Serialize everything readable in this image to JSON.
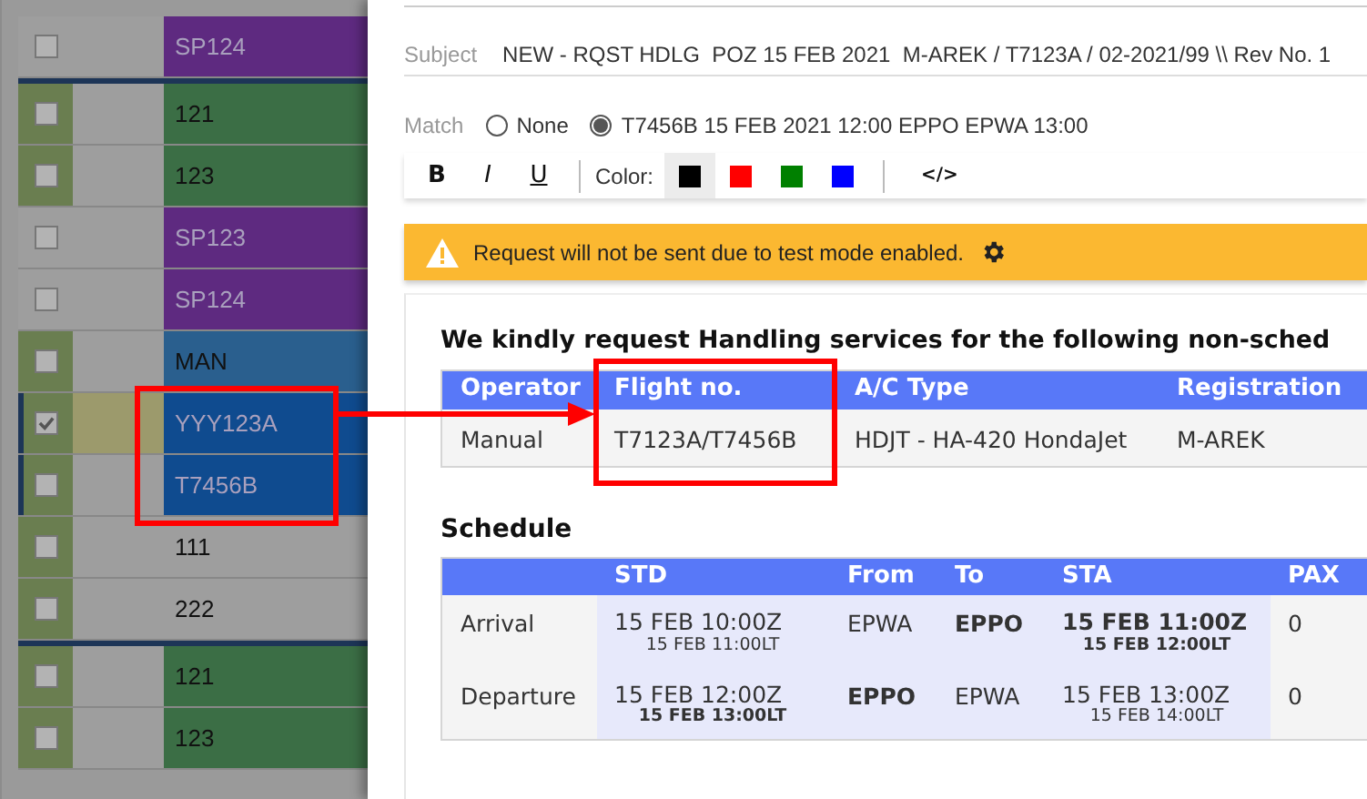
{
  "flight_list": {
    "rows": [
      {
        "flight": "SP124",
        "color": "#5e2a80",
        "faded": true,
        "checked": false,
        "flagged": false,
        "group_start": false,
        "linked": false
      },
      {
        "flight": "121",
        "color": "#3b6e45",
        "faded": false,
        "checked": false,
        "flagged": true,
        "group_start": true,
        "linked": false
      },
      {
        "flight": "123",
        "color": "#3b6e45",
        "faded": false,
        "checked": false,
        "flagged": true,
        "group_start": false,
        "linked": false
      },
      {
        "flight": "SP123",
        "color": "#5e2a80",
        "faded": true,
        "checked": false,
        "flagged": false,
        "group_start": false,
        "linked": false
      },
      {
        "flight": "SP124",
        "color": "#5e2a80",
        "faded": true,
        "checked": false,
        "flagged": false,
        "group_start": false,
        "linked": false
      },
      {
        "flight": "MAN",
        "color": "#2a5f8e",
        "faded": false,
        "checked": false,
        "flagged": true,
        "group_start": false,
        "linked": false
      },
      {
        "flight": "YYY123A",
        "color": "#0f4b8f",
        "faded": true,
        "checked": true,
        "flagged": true,
        "group_start": false,
        "linked": true
      },
      {
        "flight": "T7456B",
        "color": "#0f4b8f",
        "faded": true,
        "checked": false,
        "flagged": true,
        "group_start": false,
        "linked": true
      },
      {
        "flight": "111",
        "color": "#9e9e9e",
        "faded": false,
        "checked": false,
        "flagged": true,
        "group_start": false,
        "linked": false
      },
      {
        "flight": "222",
        "color": "#9e9e9e",
        "faded": false,
        "checked": false,
        "flagged": true,
        "group_start": false,
        "linked": false
      },
      {
        "flight": "121",
        "color": "#3b6e45",
        "faded": false,
        "checked": false,
        "flagged": true,
        "group_start": true,
        "linked": false
      },
      {
        "flight": "123",
        "color": "#3b6e45",
        "faded": false,
        "checked": false,
        "flagged": true,
        "group_start": false,
        "linked": false
      }
    ]
  },
  "message": {
    "subject": {
      "label": "Subject",
      "value": "NEW - RQST HDLG  POZ 15 FEB 2021  M-AREK / T7123A / 02-2021/99 \\\\ Rev No. 1"
    },
    "match": {
      "label": "Match",
      "options": [
        {
          "label": "None",
          "selected": false
        },
        {
          "label": "T7456B 15 FEB 2021 12:00 EPPO EPWA 13:00",
          "selected": true
        }
      ]
    },
    "toolbar": {
      "format_buttons": [
        {
          "kind": "bold",
          "label": "B"
        },
        {
          "kind": "italic",
          "label": "I"
        },
        {
          "kind": "underline",
          "label": "U"
        }
      ],
      "color_label": "Color:",
      "colors": [
        {
          "color": "#000000",
          "selected": true
        },
        {
          "color": "#ff0000",
          "selected": false
        },
        {
          "color": "#008000",
          "selected": false
        },
        {
          "color": "#0000ff",
          "selected": false
        }
      ],
      "code_button": "</>"
    },
    "warning": "Request will not be sent due to test mode enabled.",
    "body": {
      "intro": "We kindly request Handling services for the following non-sched",
      "flight_table": {
        "columns": [
          "Operator",
          "Flight no.",
          "A/C Type",
          "Registration"
        ],
        "rows": [
          [
            "Manual",
            "T7123A/T7456B",
            "HDJT - HA-420 HondaJet",
            "M-AREK"
          ]
        ]
      },
      "schedule_title": "Schedule",
      "schedule_table": {
        "columns": [
          "STD",
          "From",
          "To",
          "STA",
          "PAX"
        ],
        "rows": [
          {
            "label": "Arrival",
            "std": {
              "utc": "15 FEB 10:00Z",
              "utc_bold": false,
              "local": "15 FEB 11:00LT",
              "local_bold": false
            },
            "from": {
              "text": "EPWA",
              "bold": false
            },
            "to": {
              "text": "EPPO",
              "bold": true
            },
            "sta": {
              "utc": "15 FEB 11:00Z",
              "utc_bold": true,
              "local": "15 FEB 12:00LT",
              "local_bold": true
            },
            "pax": "0"
          },
          {
            "label": "Departure",
            "std": {
              "utc": "15 FEB 12:00Z",
              "utc_bold": false,
              "local": "15 FEB 13:00LT",
              "local_bold": true
            },
            "from": {
              "text": "EPPO",
              "bold": true
            },
            "to": {
              "text": "EPWA",
              "bold": false
            },
            "sta": {
              "utc": "15 FEB 13:00Z",
              "utc_bold": false,
              "local": "15 FEB 14:00LT",
              "local_bold": false
            },
            "pax": "0"
          }
        ]
      }
    }
  }
}
